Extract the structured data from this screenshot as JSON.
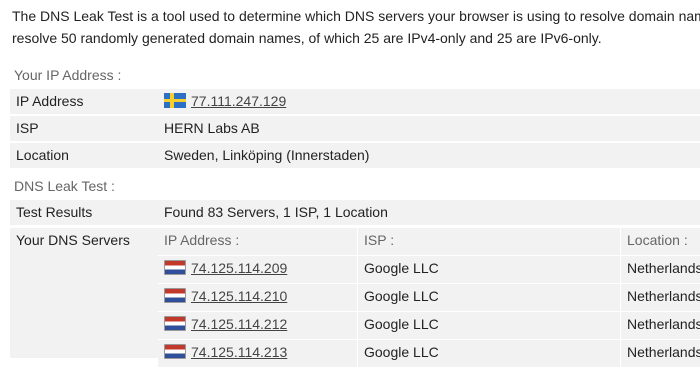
{
  "intro": {
    "line1": "The DNS Leak Test is a tool used to determine which DNS servers your browser is using to resolve domain nam",
    "line2": "resolve 50 randomly generated domain names, of which 25 are IPv4-only and 25 are IPv6-only."
  },
  "ip_section": {
    "heading": "Your IP Address :",
    "rows": [
      {
        "label": "IP Address",
        "value": "77.111.247.129",
        "flag": "sweden-flag-icon"
      },
      {
        "label": "ISP",
        "value": "HERN Labs AB"
      },
      {
        "label": "Location",
        "value": "Sweden, Linköping (Innerstaden)"
      }
    ]
  },
  "leak_section": {
    "heading": "DNS Leak Test :",
    "results_label": "Test Results",
    "results_value": "Found 83 Servers, 1 ISP, 1 Location",
    "servers_label": "Your DNS Servers",
    "columns": [
      "IP Address :",
      "ISP :",
      "Location :"
    ],
    "servers": [
      {
        "ip": "74.125.114.209",
        "isp": "Google LLC",
        "location": "Netherlands",
        "flag": "netherlands-flag-icon"
      },
      {
        "ip": "74.125.114.210",
        "isp": "Google LLC",
        "location": "Netherlands",
        "flag": "netherlands-flag-icon"
      },
      {
        "ip": "74.125.114.212",
        "isp": "Google LLC",
        "location": "Netherlands",
        "flag": "netherlands-flag-icon"
      },
      {
        "ip": "74.125.114.213",
        "isp": "Google LLC",
        "location": "Netherlands",
        "flag": "netherlands-flag-icon"
      }
    ]
  },
  "colors": {
    "row_bg": "#f2f2f2",
    "heading": "#666666",
    "text": "#222222"
  }
}
